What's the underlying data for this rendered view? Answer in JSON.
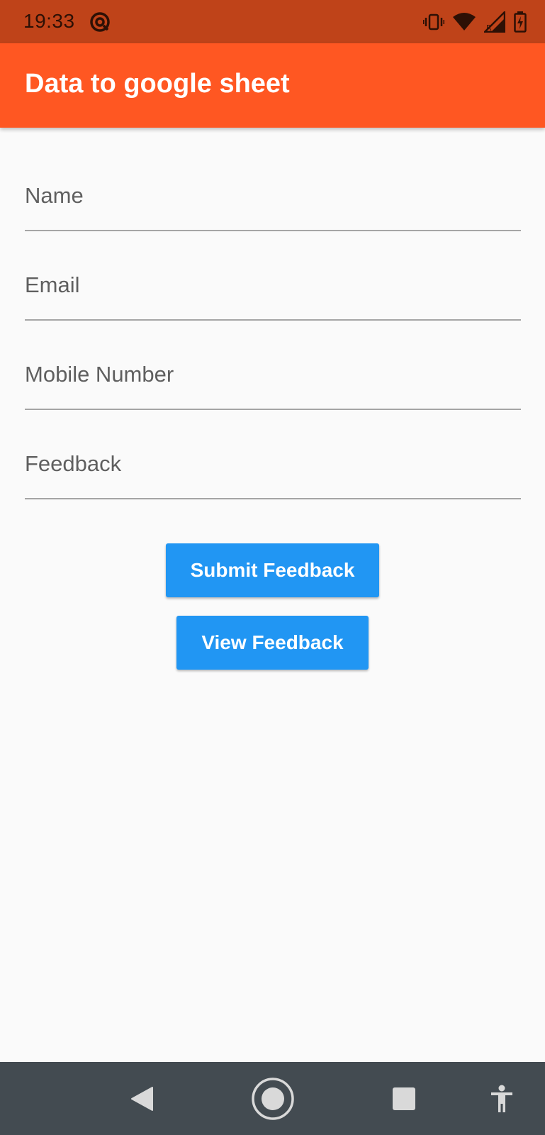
{
  "status_bar": {
    "time": "19:33",
    "icons": [
      "at-sign-icon",
      "vibrate-icon",
      "wifi-icon",
      "signal-roaming-icon",
      "battery-charging-icon"
    ]
  },
  "app_bar": {
    "title": "Data to google sheet",
    "color": "#ff5722"
  },
  "form": {
    "fields": [
      {
        "label": "Name",
        "value": ""
      },
      {
        "label": "Email",
        "value": ""
      },
      {
        "label": "Mobile Number",
        "value": ""
      },
      {
        "label": "Feedback",
        "value": ""
      }
    ]
  },
  "buttons": {
    "submit_label": "Submit Feedback",
    "view_label": "View Feedback",
    "color": "#2196f3"
  },
  "nav_bar": {
    "icons": [
      "back-icon",
      "home-icon",
      "recents-icon",
      "accessibility-icon"
    ]
  }
}
